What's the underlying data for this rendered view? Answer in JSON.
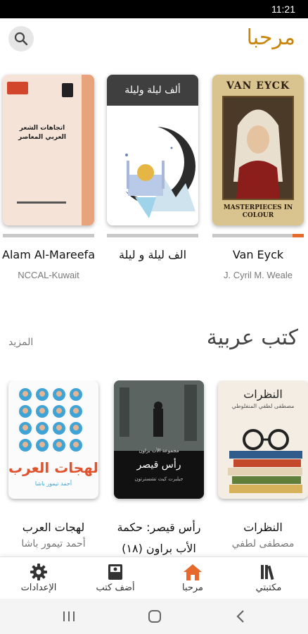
{
  "status_bar": {
    "time": "11:21"
  },
  "header": {
    "title": "مرحبا"
  },
  "featured_books": [
    {
      "title": "Van Eyck",
      "author": "J. Cyril M. Weale",
      "cover_top_text": "VAN EYCK",
      "cover_bottom_text": "MASTERPIECES IN COLOUR",
      "progress": 0.12
    },
    {
      "title": "الف ليلة و ليلة",
      "author": "",
      "cover_top_text": "ألف ليلة وليلة",
      "progress": 0
    },
    {
      "title": "Alam Al-Mareefa",
      "author": "NCCAL-Kuwait",
      "cover_top_text": "اتجاهات الشعر العربي المعاصر",
      "progress": 0
    }
  ],
  "section": {
    "title": "كتب عربية",
    "more": "المزيد"
  },
  "arabic_books": [
    {
      "title": "النظرات",
      "author": "مصطفى لطفي",
      "cover_text": "النظرات",
      "cover_sub": "مصطفى لطفي المنفلوطي"
    },
    {
      "title_line1": "رأس قيصر: حكمة",
      "title_line2": "الأب براون (١٨)",
      "author": "",
      "cover_text": "رأس قيصر",
      "cover_sub": "مجموعة الأب براون",
      "cover_bottom": "جيلبرت كيث تشسترتون"
    },
    {
      "title": "لهجات العرب",
      "author": "أحمد تيمور باشا",
      "cover_text": "لهجات العرب",
      "cover_sub": "أحمد تيمور باشا"
    }
  ],
  "bottom_nav": [
    {
      "label": "مكتبتي",
      "icon": "library-icon"
    },
    {
      "label": "مرحبا",
      "icon": "home-icon",
      "active": true
    },
    {
      "label": "أضف كتب",
      "icon": "add-book-icon"
    },
    {
      "label": "الإعدادات",
      "icon": "gear-icon"
    }
  ],
  "colors": {
    "accent": "#c9860f",
    "active_nav": "#e56a2b",
    "progress": "#e56a2b"
  }
}
